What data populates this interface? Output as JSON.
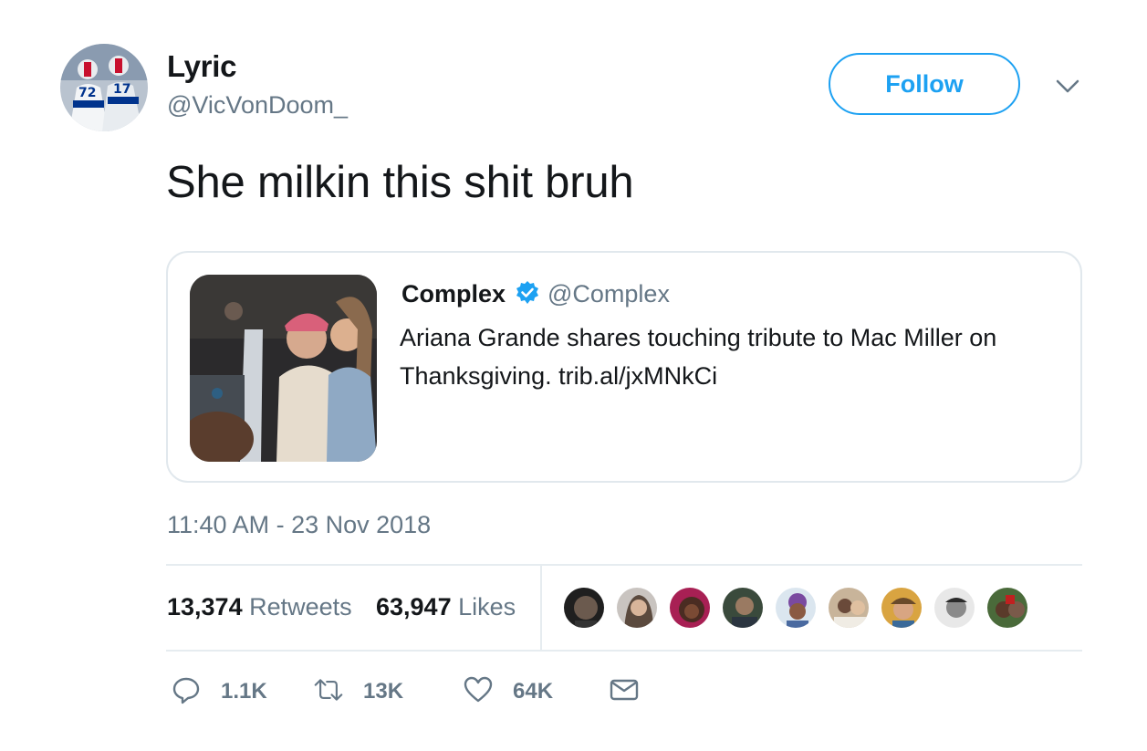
{
  "author": {
    "name": "Lyric",
    "handle": "@VicVonDoom_"
  },
  "follow_label": "Follow",
  "tweet_text": "She milkin this shit bruh",
  "quoted": {
    "name": "Complex",
    "handle": "@Complex",
    "text": "Ariana Grande shares touching tribute to Mac Miller on Thanksgiving. trib.al/jxMNkCi"
  },
  "timestamp": "11:40 AM - 23 Nov 2018",
  "stats": {
    "retweets": {
      "count": "13,374",
      "label": "Retweets"
    },
    "likes": {
      "count": "63,947",
      "label": "Likes"
    }
  },
  "actions": {
    "reply_count": "1.1K",
    "retweet_count": "13K",
    "like_count": "64K"
  },
  "colors": {
    "accent": "#1da1f2",
    "secondary_text": "#657786",
    "border": "#e1e8ed"
  },
  "icons": [
    "chevron-down-icon",
    "verified-badge-icon",
    "reply-icon",
    "retweet-icon",
    "heart-icon",
    "envelope-icon"
  ]
}
